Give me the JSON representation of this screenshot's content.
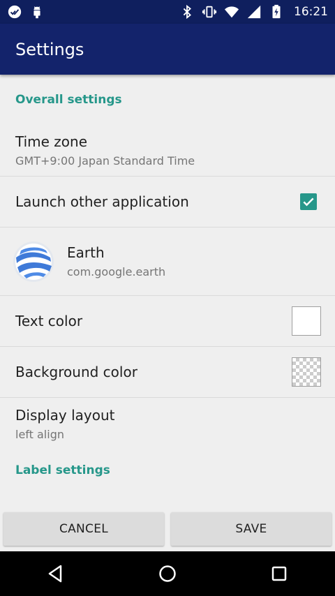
{
  "status_bar": {
    "time": "16:21",
    "icons_left": [
      "done-all-icon",
      "android-icon"
    ],
    "icons_right": [
      "bluetooth-icon",
      "vibrate-icon",
      "wifi-icon",
      "signal-icon",
      "battery-charging-icon"
    ]
  },
  "app_bar": {
    "title": "Settings"
  },
  "sections": {
    "overall": "Overall settings",
    "label": "Label settings"
  },
  "settings": {
    "time_zone": {
      "title": "Time zone",
      "value": "GMT+9:00 Japan Standard Time"
    },
    "launch_other": {
      "title": "Launch other application",
      "checked": true
    },
    "app": {
      "name": "Earth",
      "package": "com.google.earth"
    },
    "text_color": {
      "title": "Text color",
      "color": "#ffffff"
    },
    "background_color": {
      "title": "Background color",
      "color": "transparent"
    },
    "display_layout": {
      "title": "Display layout",
      "value": "left align"
    }
  },
  "buttons": {
    "cancel": "CANCEL",
    "save": "SAVE"
  },
  "colors": {
    "status_bar": "#0f1f5e",
    "app_bar": "#13236b",
    "accent": "#26978a"
  },
  "nav": [
    "back-icon",
    "home-icon",
    "recents-icon"
  ]
}
